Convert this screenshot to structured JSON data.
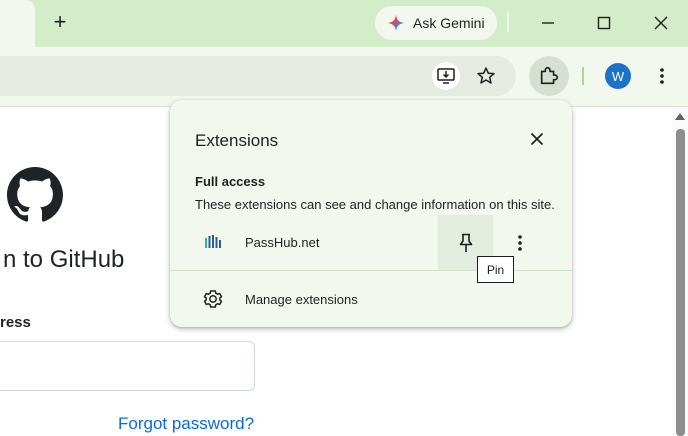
{
  "tabstrip": {
    "tab_close_glyph": "✕",
    "new_tab_glyph": "+",
    "gemini": {
      "label": "Ask Gemini",
      "icon": "gemini-sparkle-icon"
    },
    "window_controls": [
      "minimize-icon",
      "maximize-icon",
      "close-icon"
    ]
  },
  "toolbar": {
    "omnibox_icons": [
      "install-app-icon",
      "bookmark-star-icon"
    ],
    "extensions_icon": "puzzle-icon",
    "profile": {
      "initial": "W",
      "color": "#1a73c8"
    },
    "menu_icon": "three-dot-menu-icon"
  },
  "page": {
    "logo": "github-octocat-icon",
    "heading": "n to GitHub",
    "email_label": "ress",
    "email_value": "",
    "forgot_link": "Forgot password?"
  },
  "extensions_popup": {
    "title": "Extensions",
    "section_title": "Full access",
    "section_description": "These extensions can see and change information on this site.",
    "items": [
      {
        "name": "PassHub.net",
        "icon": "passhub-icon",
        "pin_icon": "pin-icon",
        "more_icon": "more-vert-icon"
      }
    ],
    "manage_label": "Manage extensions",
    "manage_icon": "gear-icon"
  },
  "tooltip": {
    "text": "Pin"
  },
  "colors": {
    "tabstrip_bg": "#d4edc9",
    "toolbar_bg": "#f3f8ef",
    "link": "#0969da",
    "avatar": "#1a73c8"
  }
}
